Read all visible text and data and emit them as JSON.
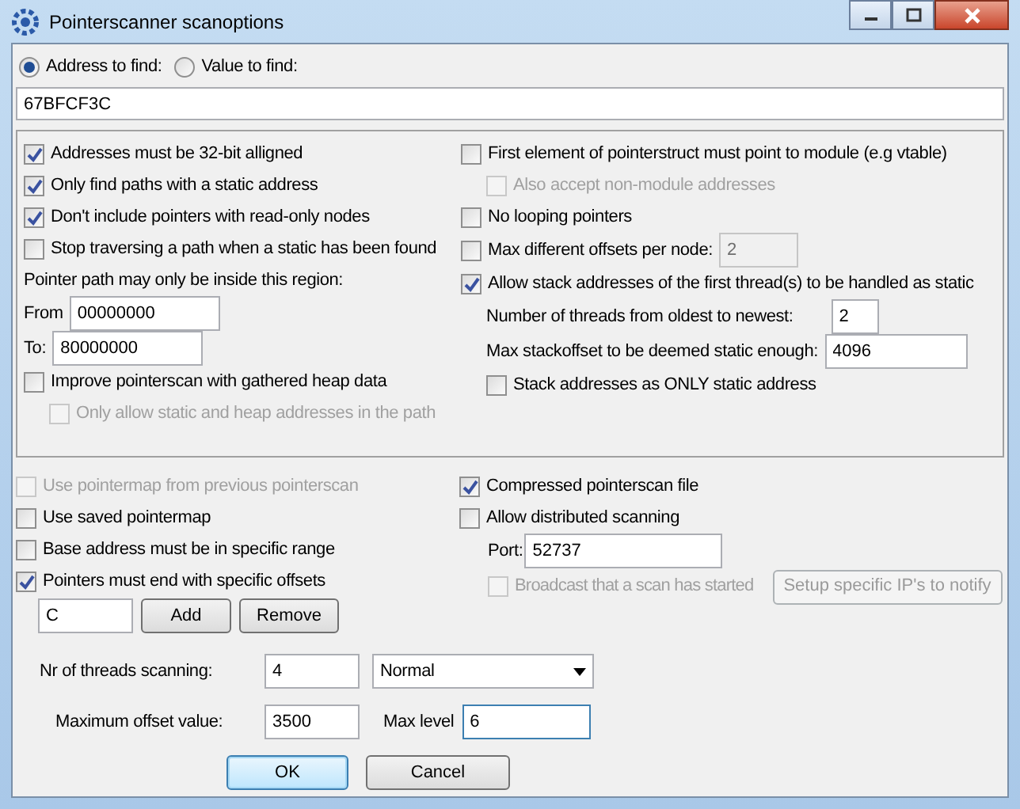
{
  "window": {
    "title": "Pointerscanner scanoptions"
  },
  "find_mode": [
    {
      "label": "Address to find:",
      "selected": true
    },
    {
      "label": "Value to find:",
      "selected": false
    }
  ],
  "address_field": {
    "value": "67BFCF3C"
  },
  "options": {
    "left": [
      {
        "kind": "checkbox",
        "label": "Addresses must be 32-bit alligned",
        "checked": true,
        "disabled": false
      },
      {
        "kind": "checkbox",
        "label": "Only find paths with a static address",
        "checked": true,
        "disabled": false
      },
      {
        "kind": "checkbox",
        "label": "Don't include pointers with read-only nodes",
        "checked": true,
        "disabled": false
      },
      {
        "kind": "checkbox",
        "label": "Stop traversing a path when a static has been found",
        "checked": false,
        "disabled": false
      },
      {
        "kind": "text",
        "label": "Pointer path may only be inside this region:"
      },
      {
        "kind": "field",
        "label": "From",
        "value": "00000000"
      },
      {
        "kind": "field",
        "label": "To:",
        "value": "80000000"
      },
      {
        "kind": "checkbox",
        "label": "Improve pointerscan with gathered heap data",
        "checked": false,
        "disabled": false,
        "children": [
          {
            "kind": "checkbox",
            "label": "Only allow static and heap addresses in the path",
            "checked": false,
            "disabled": true
          }
        ]
      }
    ],
    "right": [
      {
        "kind": "checkbox",
        "label": "First element of pointerstruct must point to module (e.g vtable)",
        "checked": false,
        "disabled": false,
        "children": [
          {
            "kind": "checkbox",
            "label": "Also accept non-module addresses",
            "checked": false,
            "disabled": true
          }
        ]
      },
      {
        "kind": "checkbox",
        "label": "No looping pointers",
        "checked": false,
        "disabled": false
      },
      {
        "kind": "checkbox",
        "label": "Max different offsets per node:",
        "checked": false,
        "disabled": false,
        "field": {
          "value": "2",
          "disabled": true
        }
      },
      {
        "kind": "checkbox",
        "label": "Allow stack addresses of the first thread(s) to be handled as static",
        "checked": true,
        "disabled": false,
        "children": [
          {
            "kind": "field",
            "label": "Number of threads from oldest to newest:",
            "value": "2"
          },
          {
            "kind": "field",
            "label": "Max stackoffset to be deemed static enough:",
            "value": "4096"
          },
          {
            "kind": "checkbox",
            "label": "Stack addresses as ONLY static address",
            "checked": false,
            "disabled": false
          }
        ]
      }
    ]
  },
  "scan_left": [
    {
      "kind": "checkbox",
      "label": "Use pointermap from previous pointerscan",
      "checked": false,
      "disabled": true
    },
    {
      "kind": "checkbox",
      "label": "Use saved pointermap",
      "checked": false,
      "disabled": false
    },
    {
      "kind": "checkbox",
      "label": "Base address must be in specific range",
      "checked": false,
      "disabled": false
    },
    {
      "kind": "checkbox",
      "label": "Pointers must end with specific offsets",
      "checked": true,
      "disabled": false
    },
    {
      "kind": "offsets",
      "value": "C",
      "buttons": [
        "Add",
        "Remove"
      ]
    }
  ],
  "scan_right": [
    {
      "kind": "checkbox",
      "label": "Compressed pointerscan file",
      "checked": true,
      "disabled": false
    },
    {
      "kind": "checkbox",
      "label": "Allow distributed scanning",
      "checked": false,
      "disabled": false
    },
    {
      "kind": "field",
      "label": "Port:",
      "value": "52737"
    },
    {
      "kind": "checkbox",
      "label": "Broadcast that a scan has started",
      "checked": false,
      "disabled": true,
      "button": {
        "label": "Setup specific IP's to notify",
        "disabled": true
      }
    }
  ],
  "threads": {
    "label": "Nr of threads scanning:",
    "value": "4",
    "priority": "Normal"
  },
  "max_offset": {
    "label": "Maximum offset value:",
    "value": "3500"
  },
  "max_level": {
    "label": "Max level",
    "value": "6",
    "focused": true
  },
  "buttons": [
    {
      "label": "OK",
      "default": true
    },
    {
      "label": "Cancel",
      "default": false
    }
  ]
}
